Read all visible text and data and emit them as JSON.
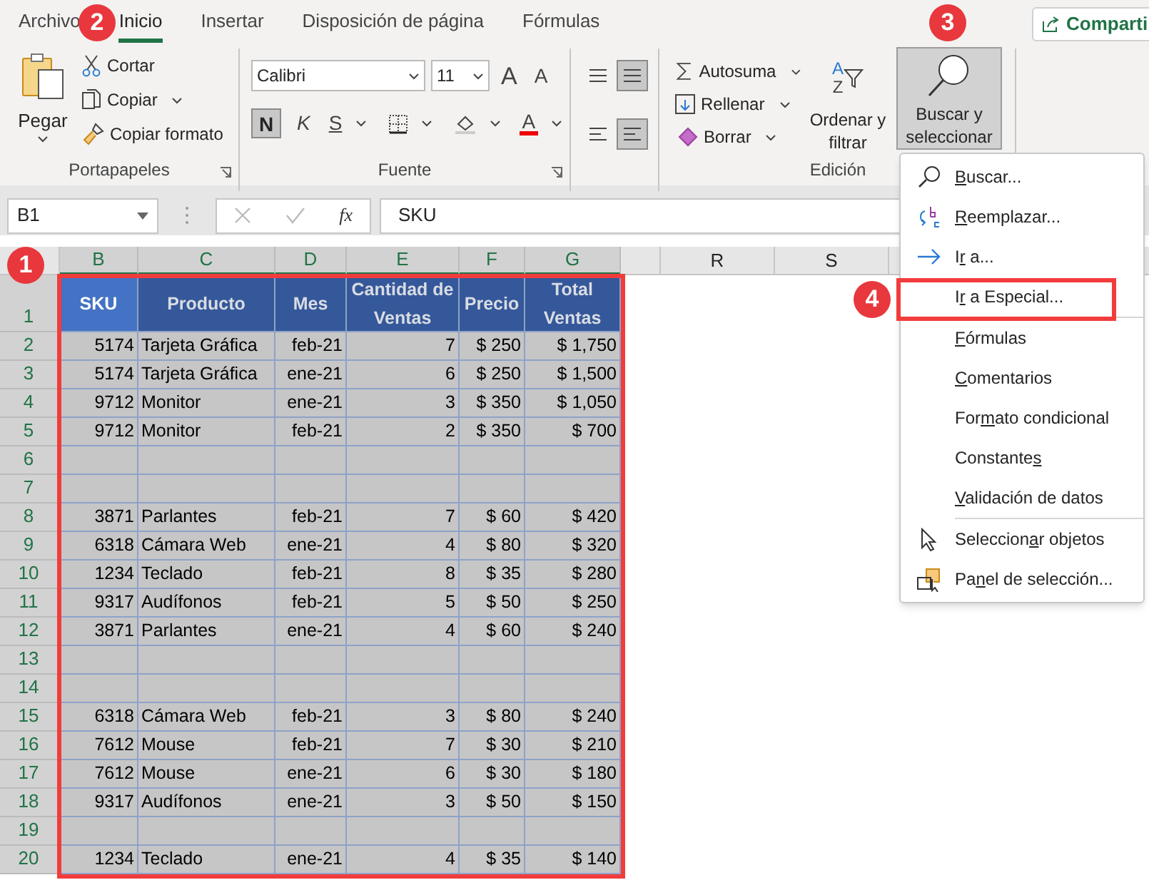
{
  "ribbon_tabs": [
    {
      "label": "Archivo",
      "selected": false
    },
    {
      "label": "Inicio",
      "selected": true
    },
    {
      "label": "Insertar",
      "selected": false
    },
    {
      "label": "Disposición de página",
      "selected": false
    },
    {
      "label": "Fórmulas",
      "selected": false
    }
  ],
  "share_button": "Comparti",
  "clipboard": {
    "paste": "Pegar",
    "cut": "Cortar",
    "copy": "Copiar",
    "format_painter": "Copiar formato",
    "title": "Portapapeles"
  },
  "font": {
    "font_name": "Calibri",
    "font_size": "11",
    "grow": "A",
    "shrink": "A",
    "bold": {
      "label": "N",
      "on": true
    },
    "italic": "K",
    "underline": "S",
    "font_color": "A",
    "title": "Fuente"
  },
  "alignment": [
    {
      "on": false
    },
    {
      "on": true
    },
    {
      "on": false
    },
    {
      "on": true
    }
  ],
  "editing": {
    "autosum": "Autosuma",
    "fill": "Rellenar",
    "clear": "Borrar",
    "sort_letters": [
      "A",
      "Z"
    ],
    "sort_filter": "Ordenar y filtrar",
    "find_select": {
      "label": "Buscar y seleccionar",
      "pressed": true
    },
    "title": "Edición"
  },
  "formula_bar": {
    "name_box": "B1",
    "function_label": "fx",
    "formula": "SKU"
  },
  "columns": [
    {
      "label": "B",
      "selected": true,
      "kind": "number"
    },
    {
      "label": "C",
      "selected": true,
      "kind": "text"
    },
    {
      "label": "D",
      "selected": true,
      "kind": "number"
    },
    {
      "label": "E",
      "selected": true,
      "kind": "number"
    },
    {
      "label": "F",
      "selected": true,
      "kind": "number"
    },
    {
      "label": "G",
      "selected": true,
      "kind": "number"
    }
  ],
  "other_columns": [
    {
      "label": "R"
    },
    {
      "label": "S"
    }
  ],
  "header_row": {
    "number": "1",
    "selected": true,
    "cells": [
      {
        "text": "SKU",
        "active": true
      },
      {
        "text": "Producto",
        "active": false
      },
      {
        "text": "Mes",
        "active": false
      },
      {
        "text": "Cantidad de Ventas",
        "active": false
      },
      {
        "text": "Precio",
        "active": false
      },
      {
        "text": "Total Ventas",
        "active": false
      }
    ]
  },
  "rows": [
    {
      "number": "2",
      "selected": true,
      "cells": [
        "5174",
        "Tarjeta Gráfica",
        "feb-21",
        "7",
        "$ 250",
        "$ 1,750"
      ]
    },
    {
      "number": "3",
      "selected": true,
      "cells": [
        "5174",
        "Tarjeta Gráfica",
        "ene-21",
        "6",
        "$ 250",
        "$ 1,500"
      ]
    },
    {
      "number": "4",
      "selected": true,
      "cells": [
        "9712",
        "Monitor",
        "ene-21",
        "3",
        "$ 350",
        "$ 1,050"
      ]
    },
    {
      "number": "5",
      "selected": true,
      "cells": [
        "9712",
        "Monitor",
        "feb-21",
        "2",
        "$ 350",
        "$ 700"
      ]
    },
    {
      "number": "6",
      "selected": true
    },
    {
      "number": "7",
      "selected": true
    },
    {
      "number": "8",
      "selected": true,
      "cells": [
        "3871",
        "Parlantes",
        "feb-21",
        "7",
        "$ 60",
        "$ 420"
      ]
    },
    {
      "number": "9",
      "selected": true,
      "cells": [
        "6318",
        "Cámara Web",
        "ene-21",
        "4",
        "$ 80",
        "$ 320"
      ]
    },
    {
      "number": "10",
      "selected": true,
      "cells": [
        "1234",
        "Teclado",
        "feb-21",
        "8",
        "$ 35",
        "$ 280"
      ]
    },
    {
      "number": "11",
      "selected": true,
      "cells": [
        "9317",
        "Audífonos",
        "feb-21",
        "5",
        "$ 50",
        "$ 250"
      ]
    },
    {
      "number": "12",
      "selected": true,
      "cells": [
        "3871",
        "Parlantes",
        "ene-21",
        "4",
        "$ 60",
        "$ 240"
      ]
    },
    {
      "number": "13",
      "selected": true
    },
    {
      "number": "14",
      "selected": true
    },
    {
      "number": "15",
      "selected": true,
      "cells": [
        "6318",
        "Cámara Web",
        "feb-21",
        "3",
        "$ 80",
        "$ 240"
      ]
    },
    {
      "number": "16",
      "selected": true,
      "cells": [
        "7612",
        "Mouse",
        "feb-21",
        "7",
        "$ 30",
        "$ 210"
      ]
    },
    {
      "number": "17",
      "selected": true,
      "cells": [
        "7612",
        "Mouse",
        "ene-21",
        "6",
        "$ 30",
        "$ 180"
      ]
    },
    {
      "number": "18",
      "selected": true,
      "cells": [
        "9317",
        "Audífonos",
        "ene-21",
        "3",
        "$ 50",
        "$ 150"
      ]
    },
    {
      "number": "19",
      "selected": true
    },
    {
      "number": "20",
      "selected": true,
      "cells": [
        "1234",
        "Teclado",
        "ene-21",
        "4",
        "$ 35",
        "$ 140"
      ]
    }
  ],
  "menu": [
    {
      "kind": "find",
      "key": "B",
      "after": "uscar..."
    },
    {
      "kind": "replace",
      "key": "R",
      "after": "eemplazar..."
    },
    {
      "kind": "goto",
      "before": "I",
      "key": "r",
      "after": " a..."
    },
    {
      "kind": "plain",
      "before": "I",
      "key": "r",
      "after": " a Especial..."
    },
    {
      "kind": "separator"
    },
    {
      "kind": "plain",
      "key": "F",
      "after": "órmulas"
    },
    {
      "kind": "plain",
      "key": "C",
      "after": "omentarios"
    },
    {
      "kind": "plain",
      "before": "For",
      "key": "m",
      "after": "ato condicional"
    },
    {
      "kind": "plain",
      "before": "Constante",
      "key": "s"
    },
    {
      "kind": "plain",
      "key": "V",
      "after": "alidación de datos"
    },
    {
      "kind": "separator"
    },
    {
      "kind": "select_objects",
      "before": "Seleccion",
      "key": "a",
      "after": "r objetos"
    },
    {
      "kind": "selection_pane",
      "before": "Pa",
      "key": "n",
      "after": "el de selección..."
    }
  ],
  "annotations": [
    {
      "label": "1"
    },
    {
      "label": "2"
    },
    {
      "label": "3"
    },
    {
      "label": "4"
    }
  ]
}
